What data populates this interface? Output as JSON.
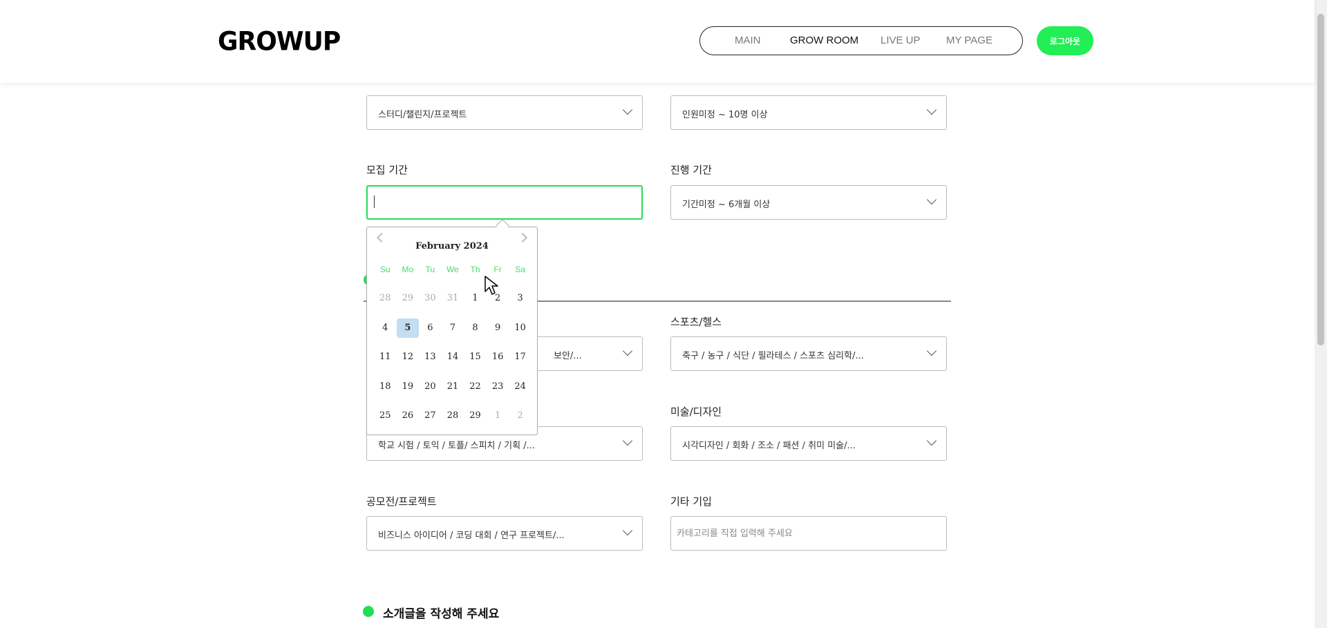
{
  "header": {
    "logo": "GROWUP",
    "nav": [
      {
        "label": "MAIN"
      },
      {
        "label": "GROW ROOM"
      },
      {
        "label": "LIVE UP"
      },
      {
        "label": "MY PAGE"
      }
    ],
    "logout_label": "로그아웃"
  },
  "form": {
    "type_select": "스터디/챌린지/프로젝트",
    "people_select": "인원미정 ~ 10명 이상",
    "recruit_period_label": "모집 기간",
    "recruit_period_value": "",
    "progress_period_label": "진행 기간",
    "progress_period_select": "기간미정 ~ 6개월 이상",
    "category_left_1_partial": "보안/...",
    "sports_label": "스포츠/헬스",
    "sports_select": "축구 / 농구 / 식단 / 필라테스 / 스포츠 심리학/...",
    "exam_select": "학교 시험 / 토익 / 토플/ 스피치 / 기획 /...",
    "art_label": "미술/디자인",
    "art_select": "시각디자인 / 회화 / 조소 / 패션 / 취미 미술/...",
    "contest_label": "공모전/프로젝트",
    "contest_select": "비즈니스 아이디어 / 코딩 대회 / 연구 프로젝트/...",
    "etc_label": "기타 기입",
    "etc_placeholder": "카테고리를 직접 입력해 주세요",
    "intro_title": "소개글을 작성해 주세요"
  },
  "datepicker": {
    "title": "February 2024",
    "weekdays": [
      "Su",
      "Mo",
      "Tu",
      "We",
      "Th",
      "Fr",
      "Sa"
    ],
    "weeks": [
      [
        "28",
        "29",
        "30",
        "31",
        "1",
        "2",
        "3"
      ],
      [
        "4",
        "5",
        "6",
        "7",
        "8",
        "9",
        "10"
      ],
      [
        "11",
        "12",
        "13",
        "14",
        "15",
        "16",
        "17"
      ],
      [
        "18",
        "19",
        "20",
        "21",
        "22",
        "23",
        "24"
      ],
      [
        "25",
        "26",
        "27",
        "28",
        "29",
        "1",
        "2"
      ]
    ]
  },
  "colors": {
    "accent": "#22ee55",
    "today": "#c3ddf2"
  }
}
